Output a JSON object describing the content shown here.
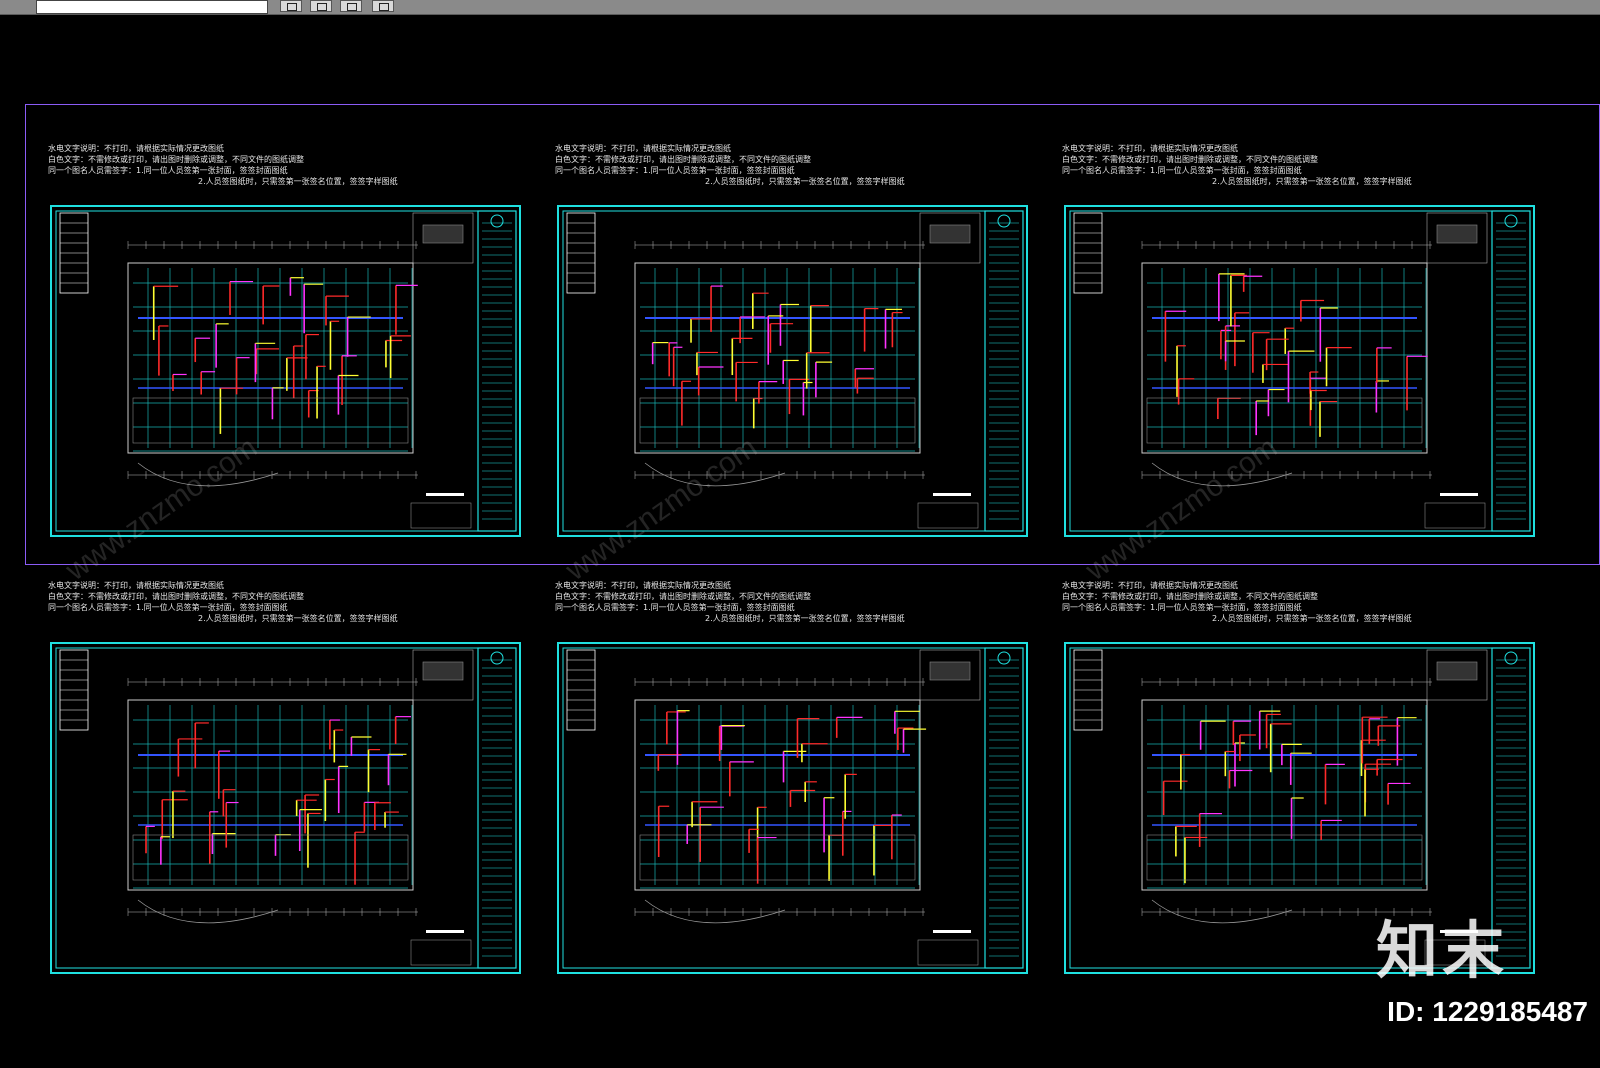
{
  "toolbar": {
    "buttons": [
      "view-icon",
      "copy-icon",
      "layers-icon",
      "print-icon"
    ]
  },
  "sheets": [
    {
      "id": "s1",
      "notes": [
        "水电文字说明：不打印，请根据实际情况更改图纸",
        "白色文字：不需修改或打印，请出图时删除或调整，不同文件的图纸调整",
        "同一个图名人员需签字：1.同一位人员签第一张封面，签签封面图纸",
        "2.人员签图纸时，只需签第一张签名位置，签签字样图纸"
      ]
    },
    {
      "id": "s2",
      "notes": [
        "水电文字说明：不打印，请根据实际情况更改图纸",
        "白色文字：不需修改或打印，请出图时删除或调整，不同文件的图纸调整",
        "同一个图名人员需签字：1.同一位人员签第一张封面，签签封面图纸",
        "2.人员签图纸时，只需签第一张签名位置，签签字样图纸"
      ]
    },
    {
      "id": "s3",
      "notes": [
        "水电文字说明：不打印，请根据实际情况更改图纸",
        "白色文字：不需修改或打印，请出图时删除或调整，不同文件的图纸调整",
        "同一个图名人员需签字：1.同一位人员签第一张封面，签签封面图纸",
        "2.人员签图纸时，只需签第一张签名位置，签签字样图纸"
      ]
    },
    {
      "id": "s4",
      "notes": [
        "水电文字说明：不打印，请根据实际情况更改图纸",
        "白色文字：不需修改或打印，请出图时删除或调整，不同文件的图纸调整",
        "同一个图名人员需签字：1.同一位人员签第一张封面，签签封面图纸",
        "2.人员签图纸时，只需签第一张签名位置，签签字样图纸"
      ]
    },
    {
      "id": "s5",
      "notes": [
        "水电文字说明：不打印，请根据实际情况更改图纸",
        "白色文字：不需修改或打印，请出图时删除或调整，不同文件的图纸调整",
        "同一个图名人员需签字：1.同一位人员签第一张封面，签签封面图纸",
        "2.人员签图纸时，只需签第一张签名位置，签签字样图纸"
      ]
    },
    {
      "id": "s6",
      "notes": [
        "水电文字说明：不打印，请根据实际情况更改图纸",
        "白色文字：不需修改或打印，请出图时删除或调整，不同文件的图纸调整",
        "同一个图名人员需签字：1.同一位人员签第一张封面，签签封面图纸",
        "2.人员签图纸时，只需签第一张签名位置，签签字样图纸"
      ]
    }
  ],
  "watermark": "www.znzmo.com",
  "brand": "知末",
  "image_id": "ID: 1229185487",
  "colors": {
    "background": "#000000",
    "frame": "#1fe0e0",
    "selection": "#8b5cf6",
    "pipe_red": "#ff2a2a",
    "pipe_magenta": "#ff33ff",
    "pipe_yellow": "#ffff33",
    "pipe_blue": "#3355ff",
    "wall_teal": "#17b2b2"
  }
}
